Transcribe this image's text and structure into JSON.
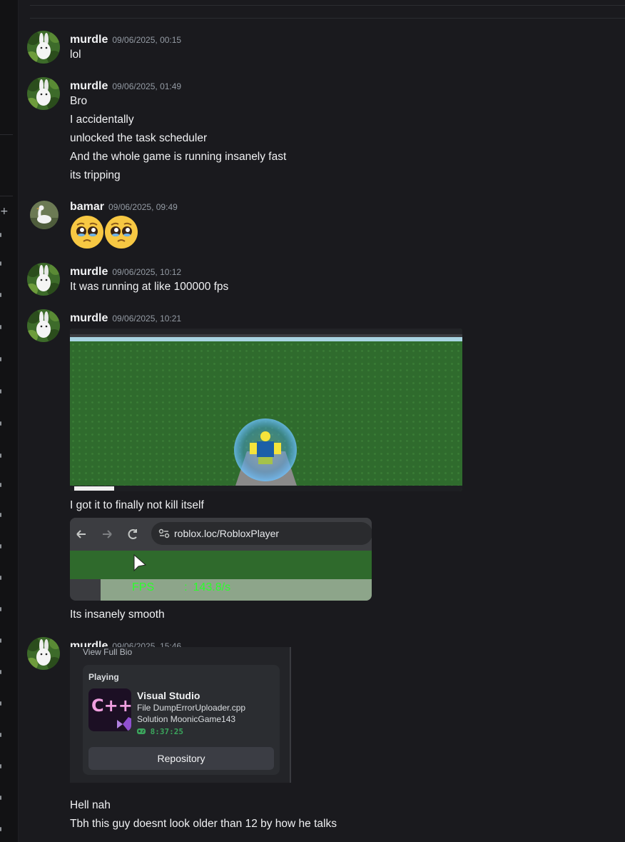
{
  "messages": [
    {
      "author": "murdle",
      "timestamp": "09/06/2025, 00:15",
      "lines": [
        "lol"
      ]
    },
    {
      "author": "murdle",
      "timestamp": "09/06/2025, 01:49",
      "lines": [
        "Bro",
        "I accidentally",
        "unlocked the task scheduler",
        "And the whole game is running insanely fast",
        "its tripping"
      ]
    },
    {
      "author": "bamar",
      "timestamp": "09/06/2025, 09:49",
      "emojis": [
        "pleading-face",
        "pleading-face"
      ]
    },
    {
      "author": "murdle",
      "timestamp": "09/06/2025, 10:12",
      "lines": [
        "It was running at like 100000 fps"
      ]
    },
    {
      "author": "murdle",
      "timestamp": "09/06/2025, 10:21",
      "lines": [
        "I got it to finally not kill itself",
        "Its insanely smooth"
      ],
      "attachment2": {
        "url": "roblox.loc/RobloxPlayer",
        "fps_label": "FPS",
        "fps_value": "143.8/s"
      }
    },
    {
      "author": "murdle",
      "timestamp": "09/06/2025, 15:46",
      "lines": [
        "Hell nah",
        "Tbh this guy doesnt look older than 12 by how he talks"
      ],
      "card": {
        "view_full_bio": "View Full Bio",
        "playing": "Playing",
        "app_title": "Visual Studio",
        "detail1": "File DumpErrorUploader.cpp",
        "detail2": "Solution MoonicGame143",
        "timer": "8:37:25",
        "button": "Repository",
        "icon_text": "C++"
      }
    }
  ],
  "colors": {
    "background": "#1a1a1e",
    "author": "#f2f3f5",
    "timestamp": "#949ba4",
    "fps_green": "#2bff2b",
    "timer_green": "#3ba55c"
  }
}
